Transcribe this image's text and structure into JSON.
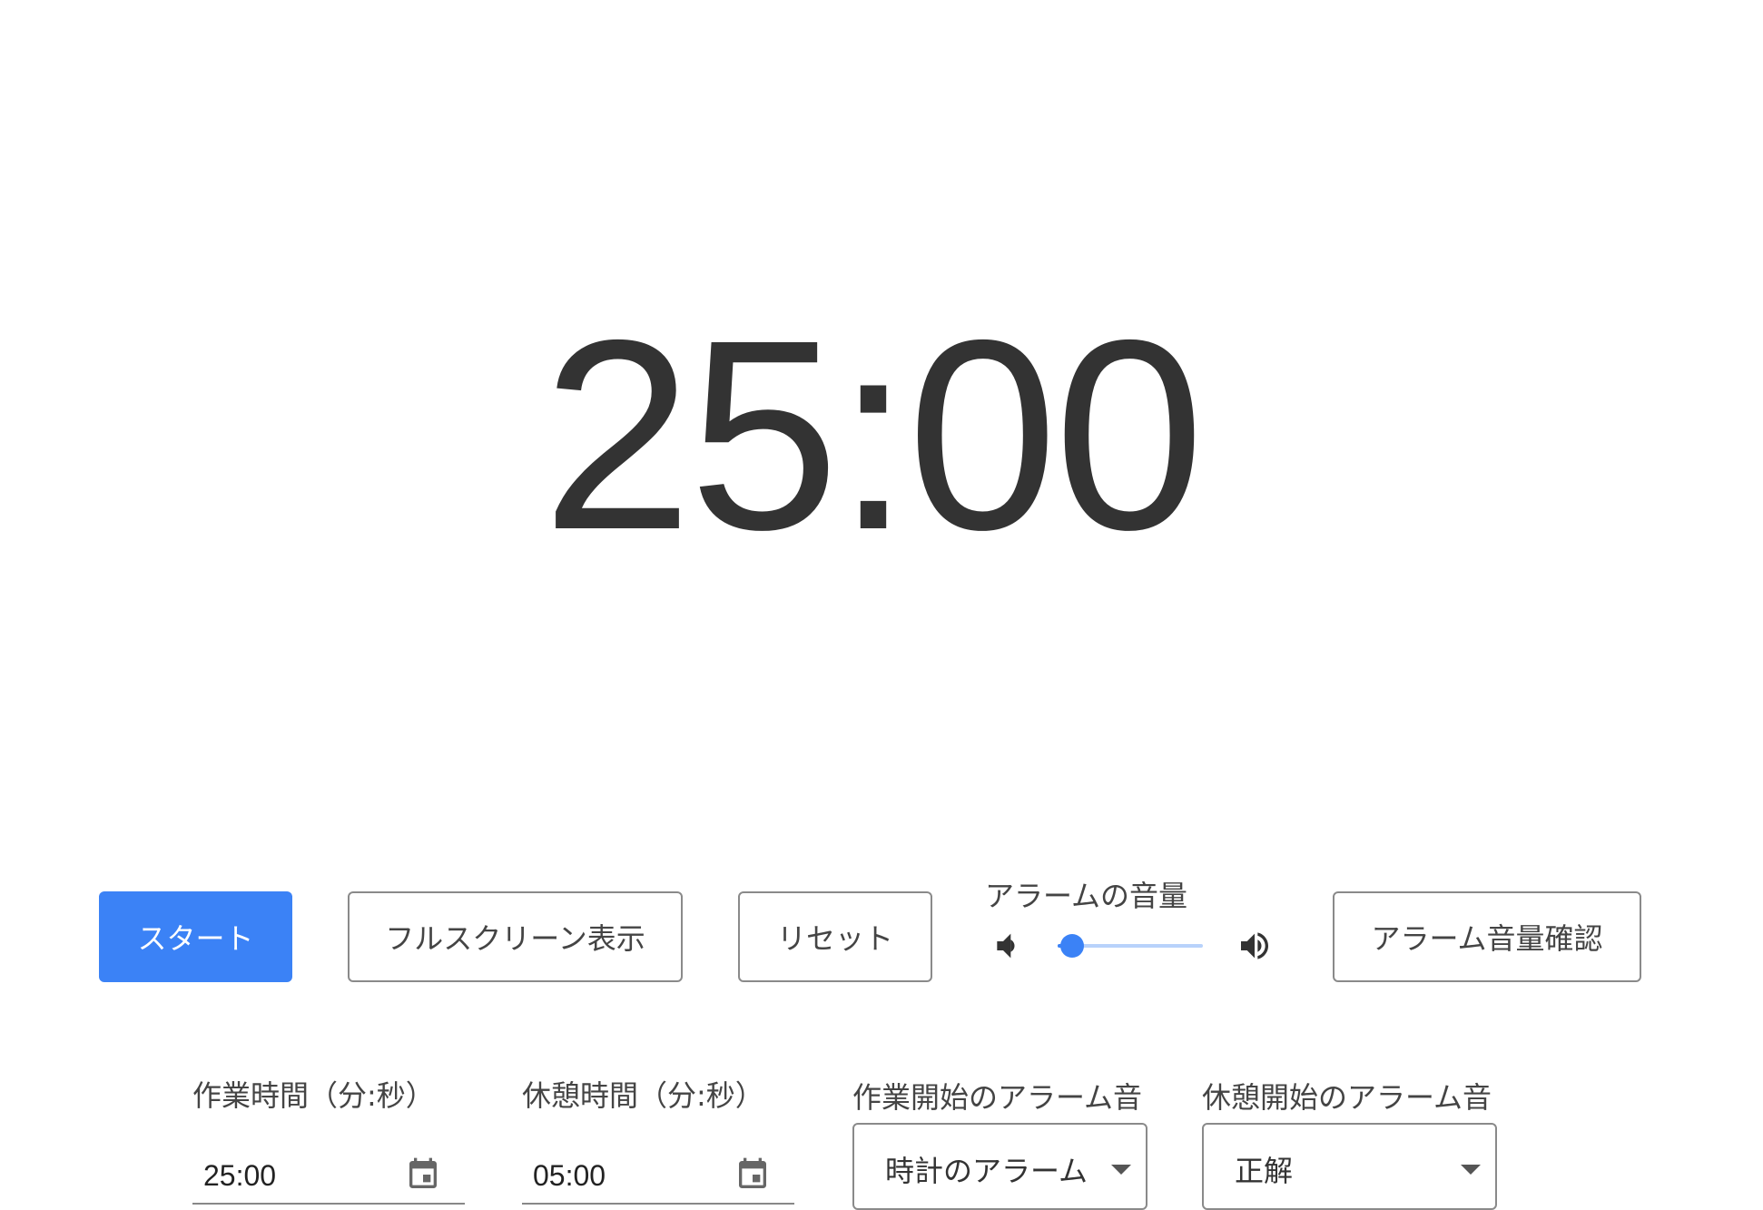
{
  "timer": {
    "display": "25:00"
  },
  "controls": {
    "start_label": "スタート",
    "fullscreen_label": "フルスクリーン表示",
    "reset_label": "リセット",
    "volume_label": "アラームの音量",
    "volume_level": 0.1,
    "volume_low_icon": "volume-low-icon",
    "volume_high_icon": "volume-high-icon",
    "alarm_check_label": "アラーム音量確認",
    "accent_color": "#3b82f6"
  },
  "settings": {
    "work_time_label": "作業時間（分:秒）",
    "work_time_value": "25:00",
    "break_time_label": "休憩時間（分:秒）",
    "break_time_value": "05:00",
    "work_alarm_label": "作業開始のアラーム音",
    "work_alarm_value": "時計のアラーム",
    "break_alarm_label": "休憩開始のアラーム音",
    "break_alarm_value": "正解",
    "calendar_icon": "calendar-icon",
    "dropdown_icon": "chevron-down-icon"
  }
}
